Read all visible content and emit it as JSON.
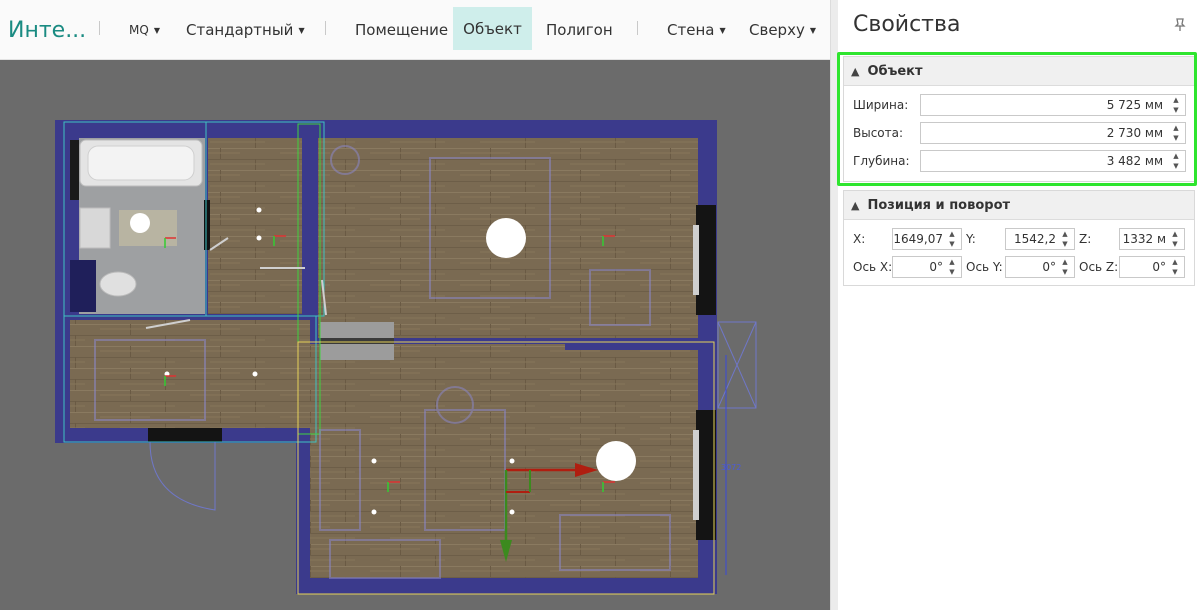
{
  "toolbar": {
    "app_title": "Инте...",
    "mq": "MQ",
    "standard": "Стандартный",
    "room": "Помещение",
    "object": "Объект",
    "polygon": "Полигон",
    "wall": "Стена",
    "top": "Сверху"
  },
  "canvas": {
    "dimension_label": "3072"
  },
  "panel": {
    "title": "Свойства",
    "object_section": {
      "title": "Объект",
      "width_label": "Ширина:",
      "width_value": "5 725 мм",
      "height_label": "Высота:",
      "height_value": "2 730 мм",
      "depth_label": "Глубина:",
      "depth_value": "3 482 мм"
    },
    "position_section": {
      "title": "Позиция и поворот",
      "x_label": "X:",
      "x_value": "1649,07",
      "y_label": "Y:",
      "y_value": "1542,2",
      "z_label": "Z:",
      "z_value": "1332 м",
      "axis_x_label": "Ось X:",
      "axis_x_value": "0°",
      "axis_y_label": "Ось Y:",
      "axis_y_value": "0°",
      "axis_z_label": "Ось Z:",
      "axis_z_value": "0°"
    }
  },
  "colors": {
    "accent": "#1a8b82",
    "active_tab": "#cfeeeb",
    "highlight": "#2ee52e",
    "wall": "#3b3a8c",
    "floor": "#7a6a52",
    "canvas_bg": "#6b6b6b"
  }
}
